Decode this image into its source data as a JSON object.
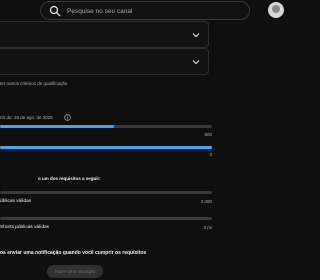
{
  "search": {
    "placeholder": "Pesquise no seu canal"
  },
  "criteria_text": "ter outros critérios de qualificação",
  "progress": {
    "date_label": "rtir de: 26 de ago. de 2025",
    "bar1": {
      "fraction": 0.54,
      "value_label": "500"
    },
    "bar2": {
      "fraction": 1.0,
      "value_label": "3"
    }
  },
  "requirements": {
    "heading": "o um dos requisitos a seguir:",
    "items": [
      {
        "label": "úblicas válidas",
        "value_label": "3.000",
        "fraction": 0.0
      },
      {
        "label": "Shorts públicas válidas",
        "value_label": "3 mi",
        "fraction": 0.0
      }
    ]
  },
  "notify": {
    "text": "os enviar uma notificação quando você cumprir os requisitos",
    "button_label": "Fazer uma inscrição"
  },
  "colors": {
    "accent": "#3ea6ff",
    "track": "#3a3a3a",
    "background": "#0f0f0f"
  },
  "icons": [
    "search-icon",
    "chevron-down-icon",
    "info-icon",
    "avatar"
  ]
}
